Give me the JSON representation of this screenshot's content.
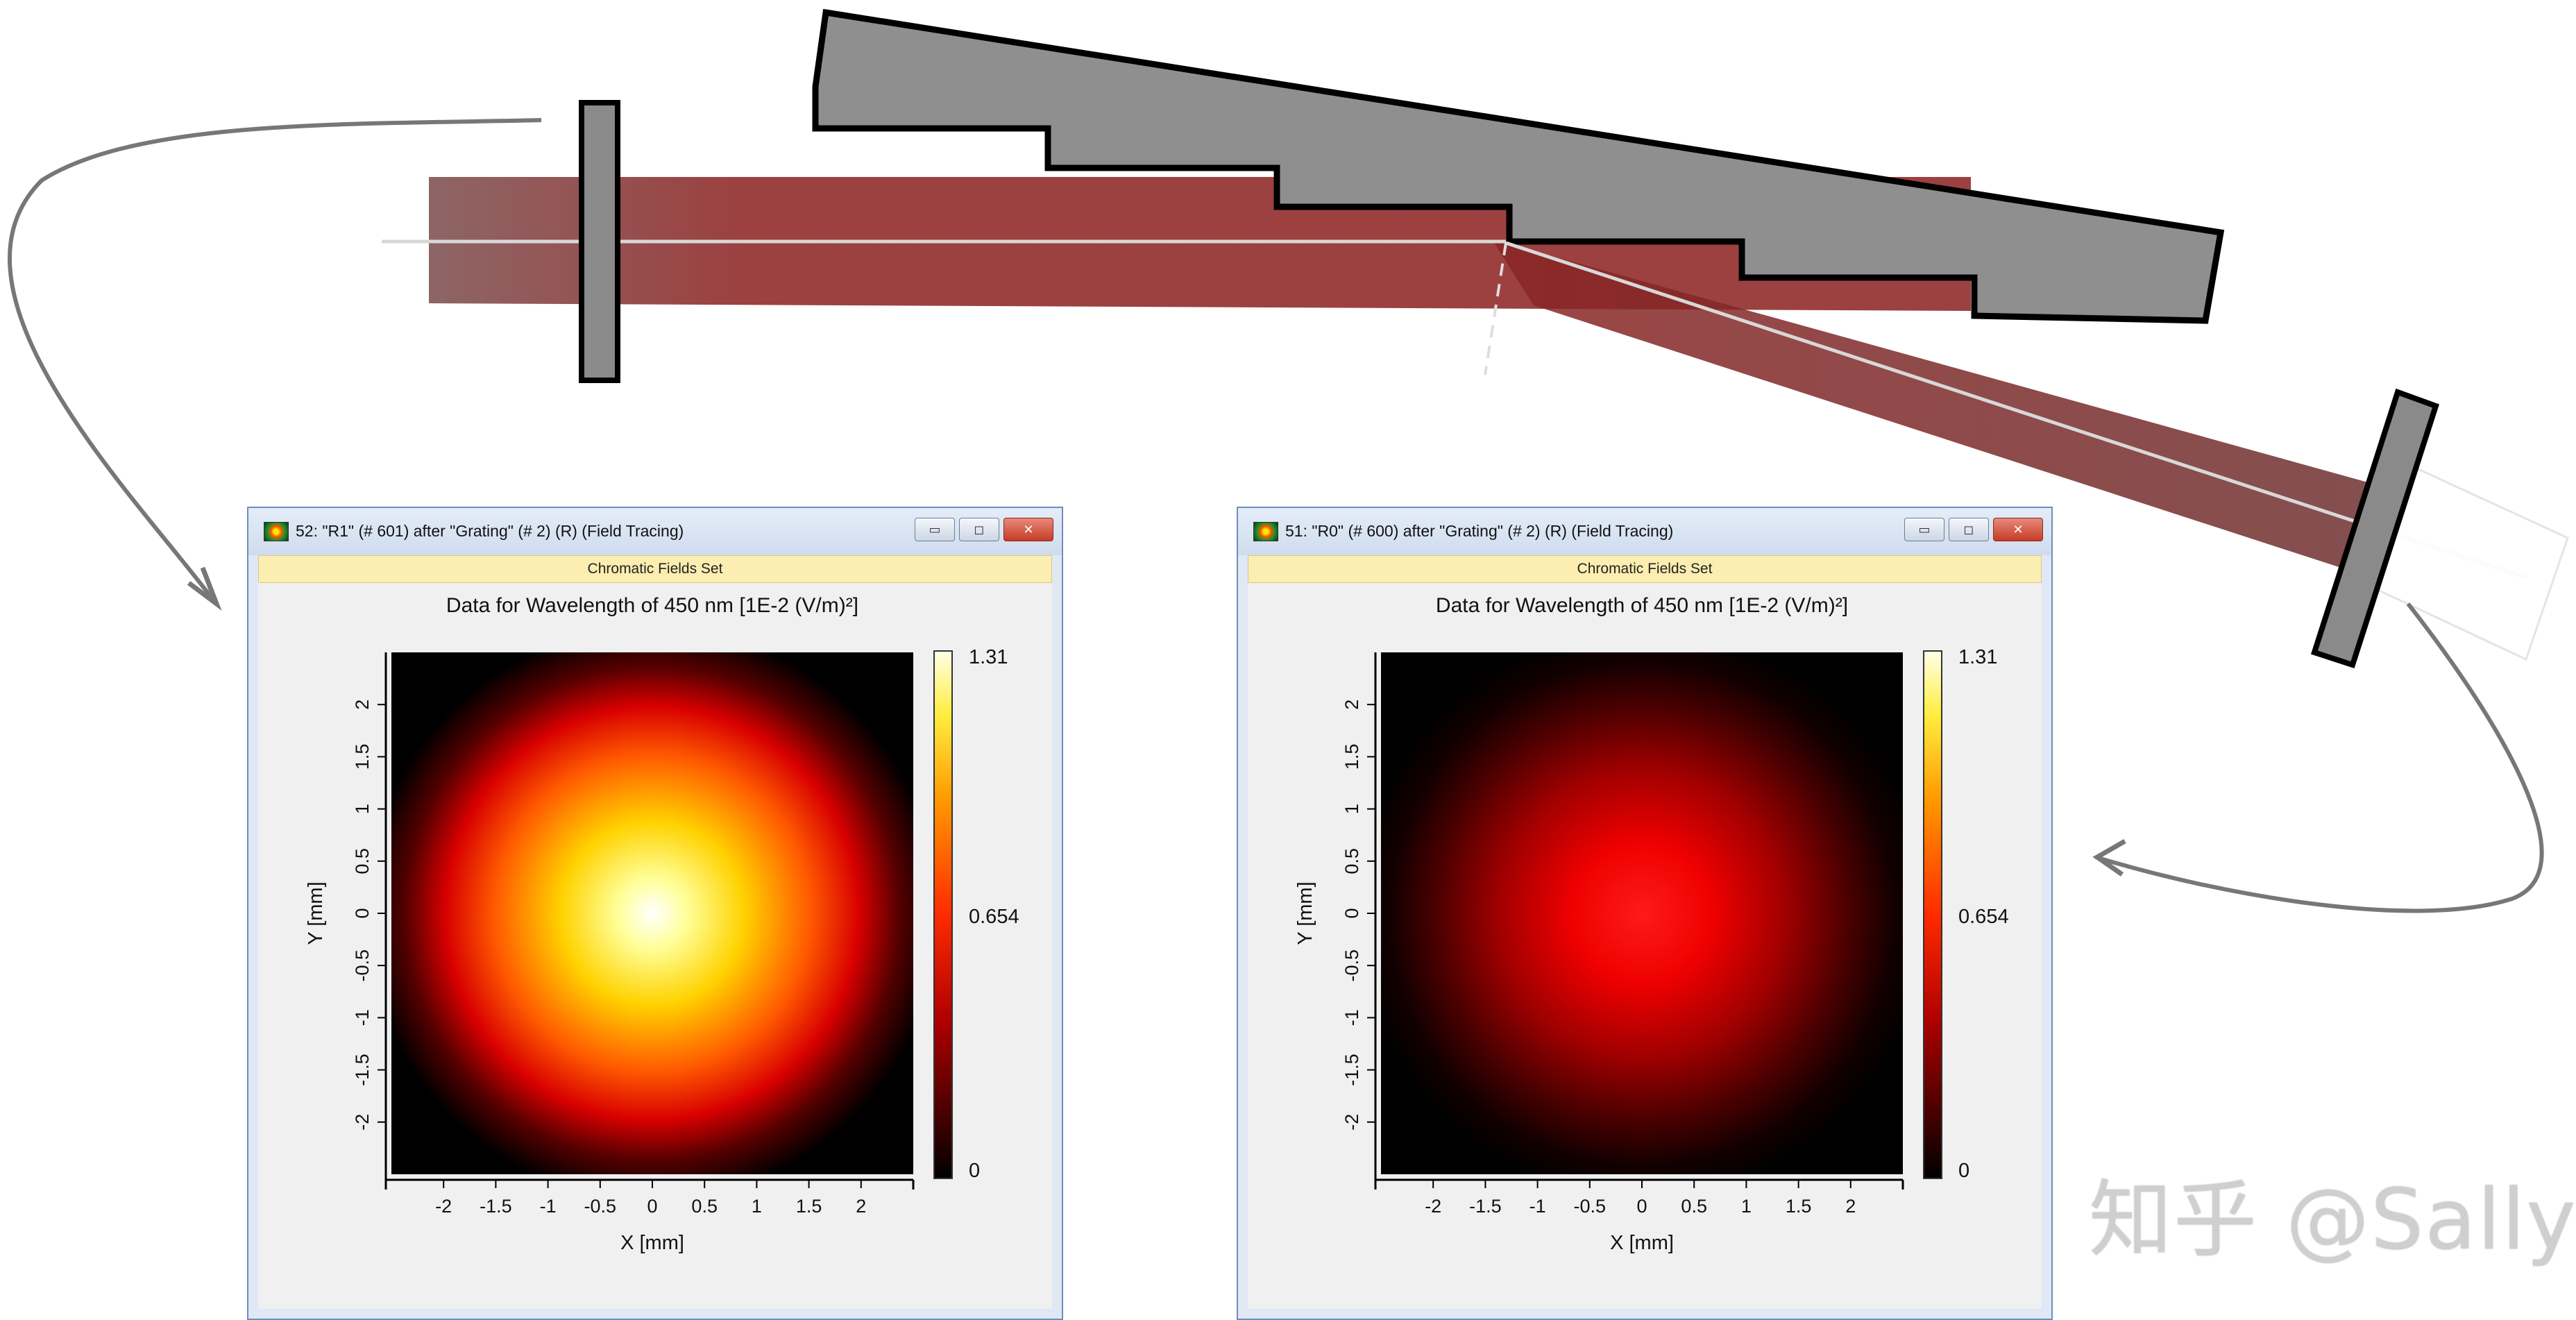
{
  "windows": [
    {
      "id": "left",
      "title": "52: \"R1\" (# 601) after \"Grating\" (# 2) (R) (Field Tracing)",
      "subtitle": "Chromatic Fields Set",
      "plot_title": "Data for Wavelength of 450 nm  [1E-2 (V/m)²]",
      "xlabel": "X [mm]",
      "ylabel": "Y [mm]",
      "colorbar": {
        "max_label": "1.31",
        "mid_label": "0.654",
        "min_label": "0"
      },
      "peak_fraction": 1.0
    },
    {
      "id": "right",
      "title": "51: \"R0\" (# 600) after \"Grating\" (# 2) (R) (Field Tracing)",
      "subtitle": "Chromatic Fields Set",
      "plot_title": "Data for Wavelength of 450 nm  [1E-2 (V/m)²]",
      "xlabel": "X [mm]",
      "ylabel": "Y [mm]",
      "colorbar": {
        "max_label": "1.31",
        "mid_label": "0.654",
        "min_label": "0"
      },
      "peak_fraction": 0.47
    }
  ],
  "axis_ticks": [
    "-2",
    "-1.5",
    "-1",
    "-0.5",
    "0",
    "0.5",
    "1",
    "1.5",
    "2"
  ],
  "window_buttons": {
    "minimize": "▭",
    "maximize": "◻",
    "close": "✕"
  },
  "watermark": "知乎 @Sally",
  "colors": {
    "beam": "#8c1b1b",
    "grating": "#8f8f8f",
    "window_border": "#6c8fb8",
    "subbar": "#fbeeb0"
  }
}
